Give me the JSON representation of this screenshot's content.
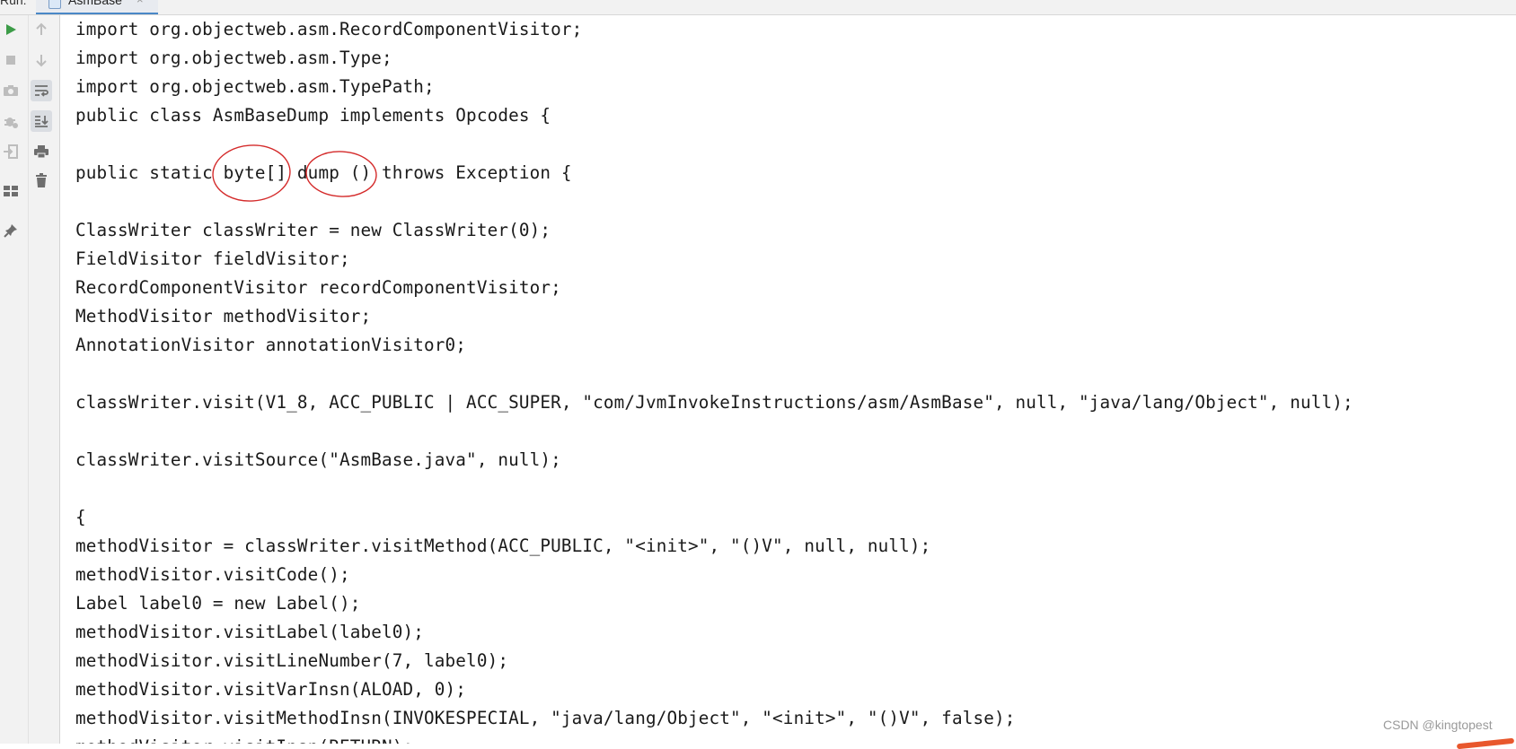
{
  "header": {
    "run_label": "Run:",
    "tab_label": "AsmBase",
    "tab_close": "×"
  },
  "toolbar": {
    "icons": [
      "run-icon",
      "stop-icon",
      "camera-icon",
      "debug-icon",
      "login-icon",
      "layout-icon",
      "pin-icon",
      "up-arrow-icon",
      "down-arrow-icon",
      "soft-wrap-icon",
      "scroll-to-end-icon",
      "print-icon",
      "trash-icon"
    ]
  },
  "code": {
    "lines": [
      "import org.objectweb.asm.RecordComponentVisitor;",
      "import org.objectweb.asm.Type;",
      "import org.objectweb.asm.TypePath;",
      "public class AsmBaseDump implements Opcodes {",
      "",
      "public static byte[] dump () throws Exception {",
      "",
      "ClassWriter classWriter = new ClassWriter(0);",
      "FieldVisitor fieldVisitor;",
      "RecordComponentVisitor recordComponentVisitor;",
      "MethodVisitor methodVisitor;",
      "AnnotationVisitor annotationVisitor0;",
      "",
      "classWriter.visit(V1_8, ACC_PUBLIC | ACC_SUPER, \"com/JvmInvokeInstructions/asm/AsmBase\", null, \"java/lang/Object\", null);",
      "",
      "classWriter.visitSource(\"AsmBase.java\", null);",
      "",
      "{",
      "methodVisitor = classWriter.visitMethod(ACC_PUBLIC, \"<init>\", \"()V\", null, null);",
      "methodVisitor.visitCode();",
      "Label label0 = new Label();",
      "methodVisitor.visitLabel(label0);",
      "methodVisitor.visitLineNumber(7, label0);",
      "methodVisitor.visitVarInsn(ALOAD, 0);",
      "methodVisitor.visitMethodInsn(INVOKESPECIAL, \"java/lang/Object\", \"<init>\", \"()V\", false);",
      "methodVisitor.visitInsn(RETURN);"
    ]
  },
  "annotations": {
    "color": "#d42a2a",
    "circled": [
      "byte[]",
      "dump ()"
    ]
  },
  "watermark": "CSDN @kingtopest",
  "colors": {
    "run_green": "#3d9c48",
    "accent_blue": "#4a88c7",
    "annotation_red": "#d42a2a"
  }
}
